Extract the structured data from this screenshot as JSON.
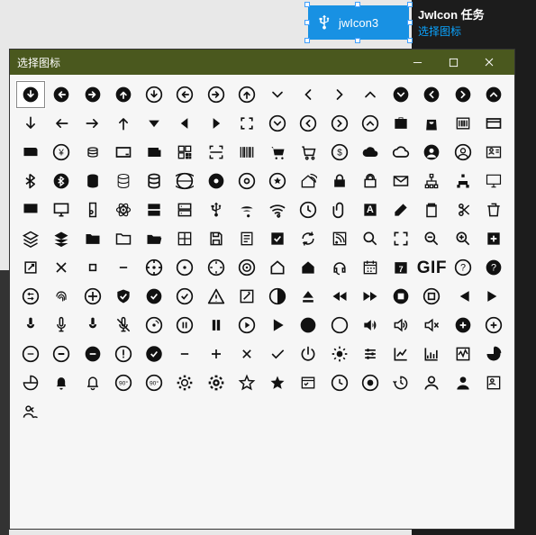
{
  "selected_control": {
    "label": "jwIcon3",
    "icon": "usb"
  },
  "task_panel": {
    "title": "JwIcon 任务",
    "link": "选择图标"
  },
  "picker": {
    "title": "选择图标",
    "win_buttons": {
      "min": "minimize",
      "max": "maximize",
      "close": "close"
    },
    "selected_index": 0,
    "gif_label": "GIF",
    "icons": [
      "arrow-down-circle-fill",
      "arrow-left-circle-fill",
      "arrow-right-circle-fill",
      "arrow-up-circle-fill",
      "arrow-down-circle",
      "arrow-left-circle",
      "arrow-right-circle",
      "arrow-up-circle",
      "chevron-down",
      "chevron-left",
      "chevron-right",
      "chevron-up",
      "chevron-down-circle-fill",
      "chevron-left-circle-fill",
      "chevron-right-circle-fill",
      "chevron-up-circle-fill",
      "arrow-down",
      "arrow-left",
      "arrow-right",
      "arrow-up",
      "caret-down-fill",
      "caret-left-fill",
      "caret-right-fill",
      "arrows-expand",
      "chevron-down-circle",
      "chevron-left-circle",
      "chevron-right-circle",
      "chevron-up-circle",
      "briefcase-fill",
      "shopping-bag-fill",
      "barcode-box",
      "credit-card-alt",
      "wallet-fill",
      "yen-circle",
      "coins-stack",
      "card-outline",
      "wallet-alt",
      "qr-code",
      "scan-frame",
      "barcode",
      "shopping-cart",
      "cart-outline",
      "dollar-circle",
      "cloud-fill",
      "cloud-outline",
      "user-circle-fill",
      "user-circle",
      "contact-card",
      "bluetooth",
      "bluetooth-circle-fill",
      "database-fill",
      "database-thin",
      "database",
      "globe",
      "disc-fill",
      "disc",
      "star-circle",
      "home-signal",
      "lock-fill",
      "lock",
      "mail",
      "sitemap",
      "sitemap-alt",
      "monitor-frame",
      "monitor-fill",
      "monitor",
      "ipod",
      "atom",
      "server-fill",
      "server",
      "usb",
      "wifi-fill",
      "wifi",
      "clock-outline",
      "paperclip",
      "font-box",
      "eraser",
      "clipboard",
      "scissors",
      "trash",
      "layers",
      "layers-fill",
      "folder-fill",
      "folder",
      "folder-open",
      "layout-grid",
      "save",
      "note",
      "checkbox-fill",
      "refresh",
      "rss-square",
      "search",
      "maximize",
      "zoom-out",
      "zoom-in",
      "add-square-fill",
      "external-link",
      "x-icon",
      "square-small",
      "minus-small",
      "target-crosshair",
      "dot-target",
      "location-target",
      "target-circle",
      "home-outline",
      "home-fill",
      "headset",
      "calendar-grid",
      "calendar-7",
      "gif-icon",
      "help-circle",
      "help-circle-fill",
      "sliders-circle",
      "fingerprint",
      "cross-circle",
      "shield-check-fill",
      "check-circle-fill",
      "check-circle",
      "warning-triangle",
      "edit-square",
      "contrast",
      "eject-fill",
      "rewind-fill",
      "forward-fill",
      "stop-circle-fill",
      "stop-circle",
      "skip-back",
      "skip-forward",
      "mic-fill",
      "mic",
      "mic-off-fill",
      "mic-off",
      "music-disc",
      "pause-circle",
      "pause-bars",
      "play-circle",
      "play-fill",
      "circle-large-fill",
      "circle-large",
      "volume-fill",
      "volume",
      "volume-mute",
      "plus-circle-fill",
      "plus-circle",
      "minus-circle",
      "minus-circle-alt",
      "minus-circle-fill",
      "warning-circle",
      "check-disc",
      "minus-small-2",
      "plus-small",
      "x-small",
      "check-small",
      "power",
      "sun",
      "settings-sliders",
      "line-chart",
      "bar-chart",
      "activity-square",
      "pie-fill",
      "pie-outline",
      "bell-fill",
      "bell",
      "rotate-90",
      "rotate-90-alt",
      "gear",
      "gear-fill",
      "star-outline",
      "star-fill",
      "list-select",
      "clock-alt",
      "record-outline",
      "time-history",
      "user",
      "user-fill",
      "card-id",
      "users"
    ]
  }
}
